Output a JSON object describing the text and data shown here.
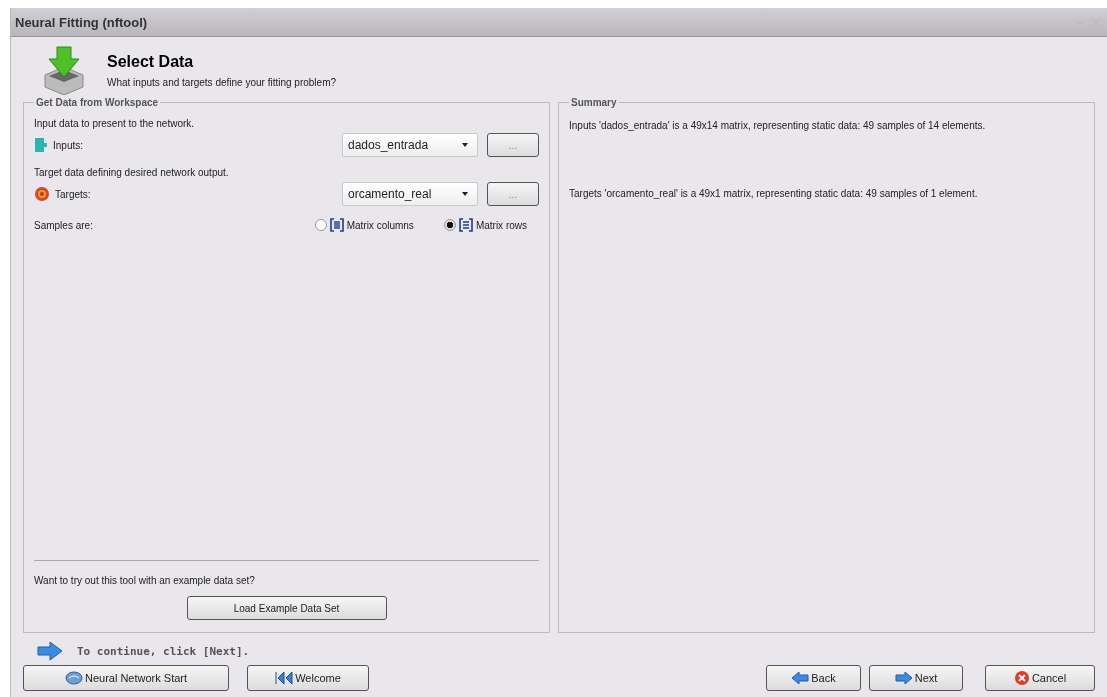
{
  "window": {
    "title": "Neural Fitting (nftool)"
  },
  "header": {
    "title": "Select Data",
    "subtitle": "What inputs and targets define your fitting problem?"
  },
  "workspace": {
    "legend": "Get Data from Workspace",
    "sources": [
      {
        "kind": "inputs",
        "prompt": "Input data to present to the network.",
        "label": "Inputs:",
        "value": "dados_entrada",
        "button": "..."
      },
      {
        "kind": "targets",
        "prompt": "Target data defining desired network output.",
        "label": "Targets:",
        "value": "orcamento_real",
        "button": "..."
      }
    ],
    "samples": {
      "label": "Samples are:",
      "options": [
        {
          "kind": "columns",
          "label": "Matrix columns",
          "selected": false
        },
        {
          "kind": "rows",
          "label": "Matrix rows",
          "selected": true
        }
      ]
    },
    "example": {
      "prompt": "Want to try out this tool with an example data set?",
      "button": "Load Example Data Set"
    }
  },
  "summary": {
    "legend": "Summary",
    "lines": [
      "Inputs 'dados_entrada' is a 49x14 matrix, representing static data: 49 samples of 14 elements.",
      "Targets 'orcamento_real' is a 49x1 matrix, representing static data: 49 samples of 1 element."
    ]
  },
  "hint": "To continue, click [Next].",
  "buttons": [
    {
      "kind": "start",
      "label": "Neural Network Start"
    },
    {
      "kind": "welcome",
      "label": "Welcome"
    },
    {
      "kind": "back",
      "label": "Back"
    },
    {
      "kind": "next",
      "label": "Next"
    },
    {
      "kind": "cancel",
      "label": "Cancel"
    }
  ]
}
